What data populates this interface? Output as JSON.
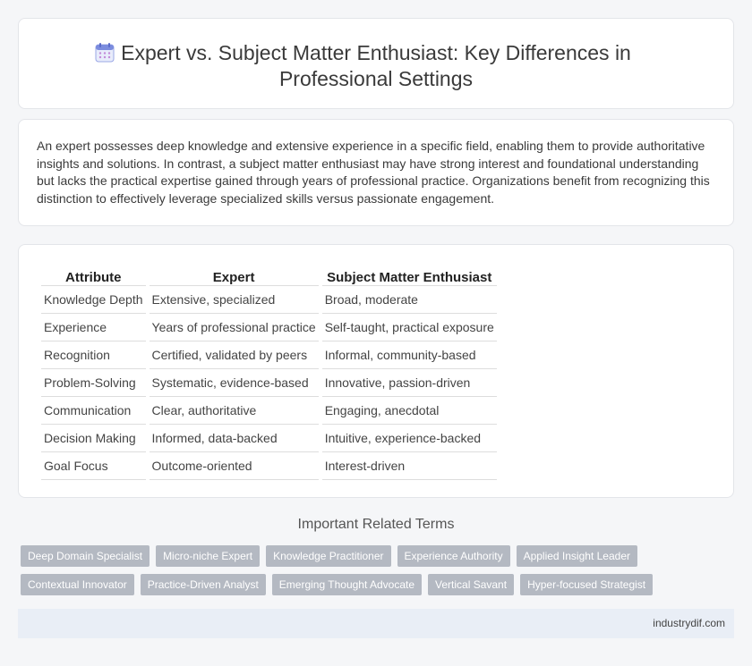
{
  "header": {
    "title": "Expert vs. Subject Matter Enthusiast: Key Differences in Professional Settings",
    "icon": "calendar-icon"
  },
  "intro": "An expert possesses deep knowledge and extensive experience in a specific field, enabling them to provide authoritative insights and solutions. In contrast, a subject matter enthusiast may have strong interest and foundational understanding but lacks the practical expertise gained through years of professional practice. Organizations benefit from recognizing this distinction to effectively leverage specialized skills versus passionate engagement.",
  "table": {
    "headers": [
      "Attribute",
      "Expert",
      "Subject Matter Enthusiast"
    ],
    "rows": [
      [
        "Knowledge Depth",
        "Extensive, specialized",
        "Broad, moderate"
      ],
      [
        "Experience",
        "Years of professional practice",
        "Self-taught, practical exposure"
      ],
      [
        "Recognition",
        "Certified, validated by peers",
        "Informal, community-based"
      ],
      [
        "Problem-Solving",
        "Systematic, evidence-based",
        "Innovative, passion-driven"
      ],
      [
        "Communication",
        "Clear, authoritative",
        "Engaging, anecdotal"
      ],
      [
        "Decision Making",
        "Informed, data-backed",
        "Intuitive, experience-backed"
      ],
      [
        "Goal Focus",
        "Outcome-oriented",
        "Interest-driven"
      ]
    ]
  },
  "related": {
    "title": "Important Related Terms",
    "row1": [
      "Deep Domain Specialist",
      "Micro-niche Expert",
      "Knowledge Practitioner",
      "Experience Authority",
      "Applied Insight Leader"
    ],
    "row2": [
      "Contextual Innovator",
      "Practice-Driven Analyst",
      "Emerging Thought Advocate",
      "Vertical Savant",
      "Hyper-focused Strategist"
    ]
  },
  "footer": {
    "site": "industrydif.com"
  },
  "colors": {
    "tag_bg": "#b4b9c2",
    "footer_bg": "#e9eef6",
    "icon_accent": "#7b8cde"
  }
}
